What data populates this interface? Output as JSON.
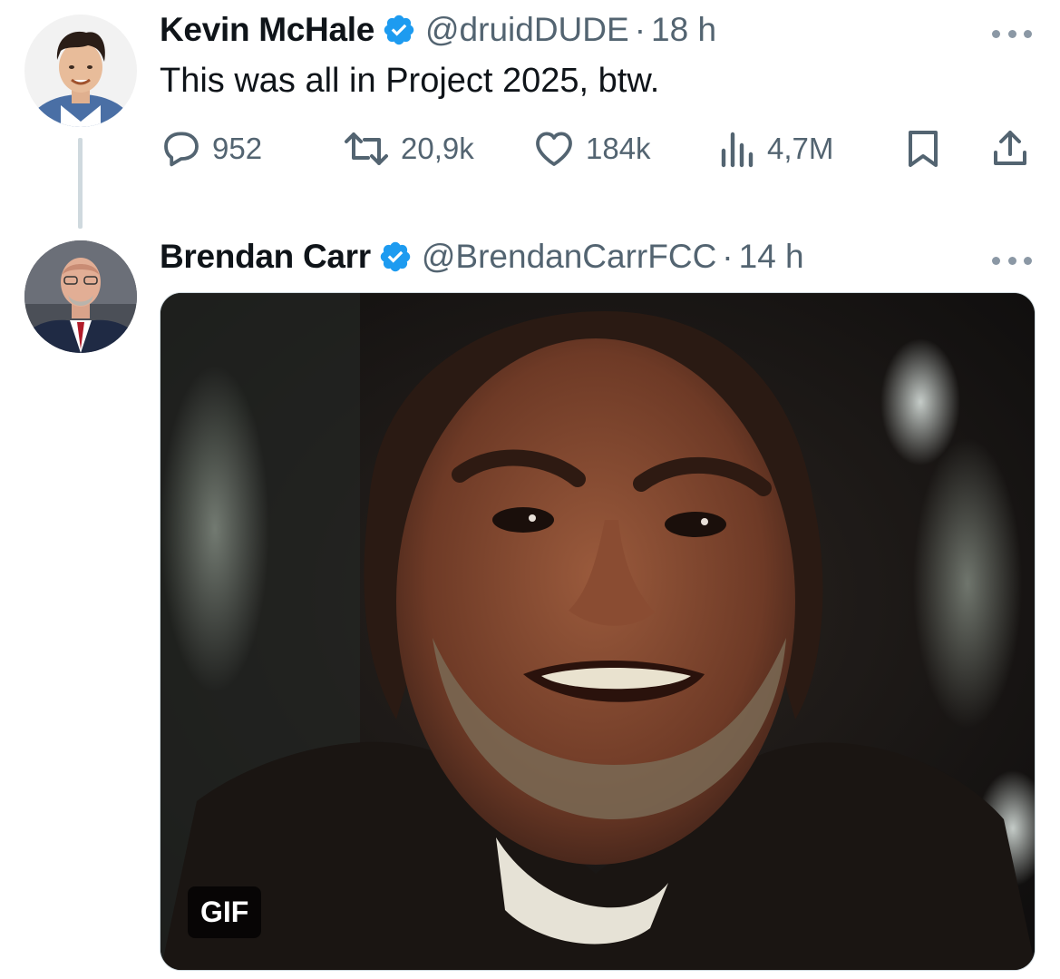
{
  "tweet1": {
    "name": "Kevin McHale",
    "handle": "@druidDUDE",
    "separator": "·",
    "time": "18 h",
    "text": "This was all in Project 2025, btw.",
    "stats": {
      "replies": "952",
      "reposts": "20,9k",
      "likes": "184k",
      "views": "4,7M"
    }
  },
  "tweet2": {
    "name": "Brendan Carr",
    "handle": "@BrendanCarrFCC",
    "separator": "·",
    "time": "14 h",
    "media_badge": "GIF"
  },
  "colors": {
    "verified": "#1d9bf0",
    "secondary_text": "#536471",
    "thread_line": "#cfd9de"
  },
  "icons": [
    "verified-badge-icon",
    "more-icon",
    "reply-icon",
    "repost-icon",
    "like-icon",
    "views-icon",
    "bookmark-icon",
    "share-icon"
  ]
}
